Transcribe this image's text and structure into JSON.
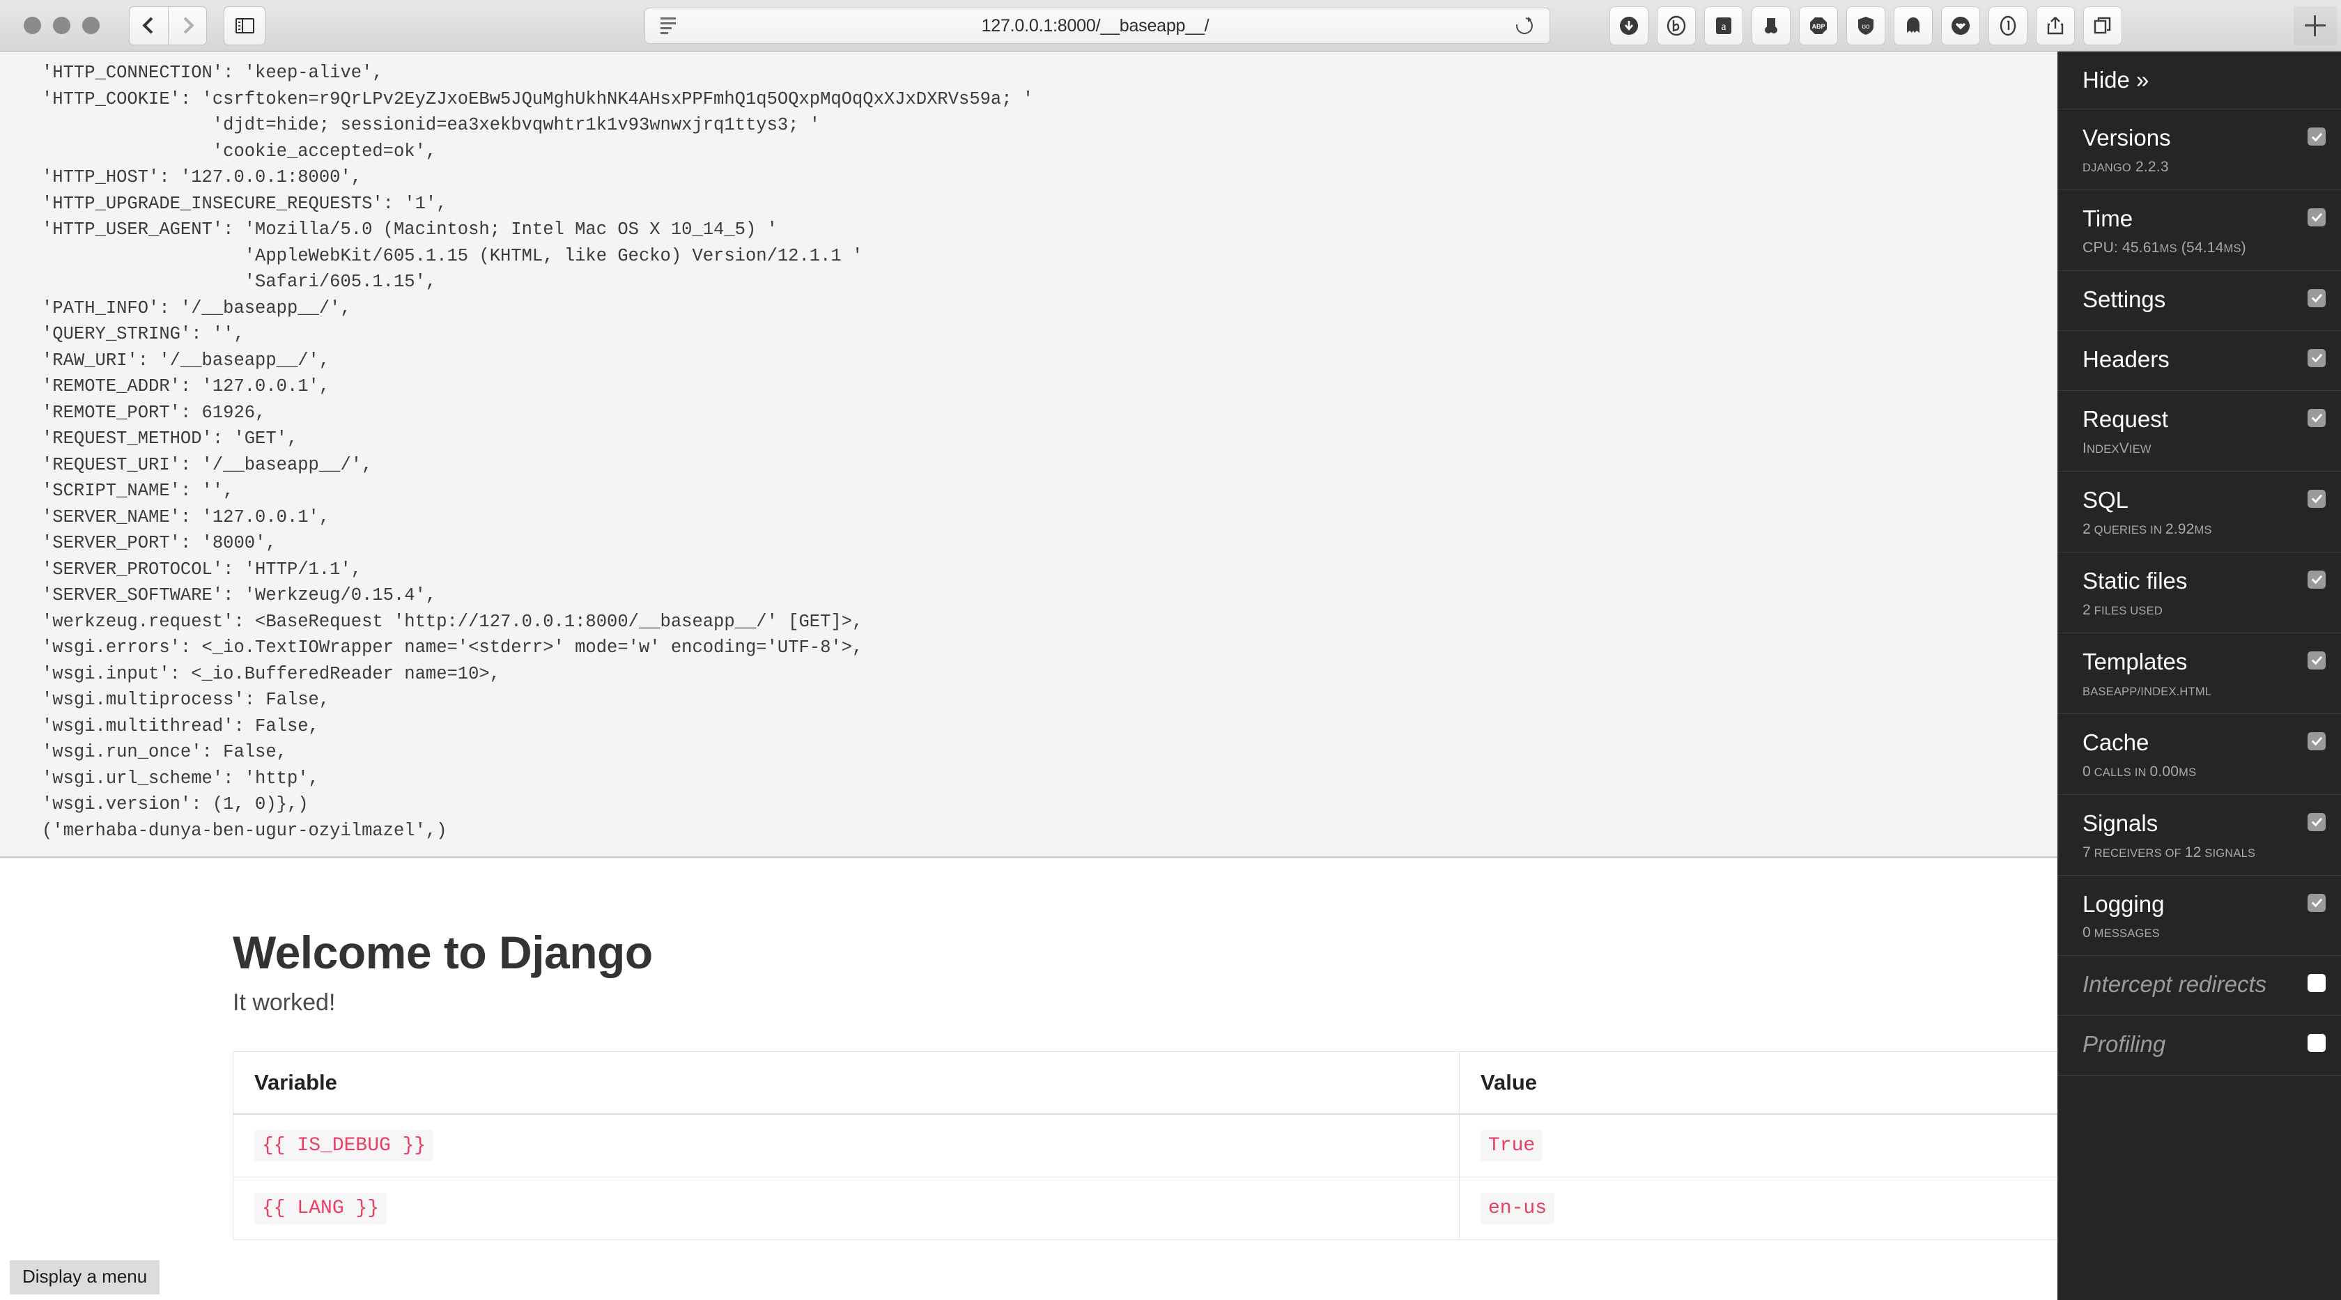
{
  "browser": {
    "window_controls": [
      "close",
      "minimize",
      "maximize"
    ],
    "back_label": "Back",
    "forward_label": "Forward",
    "sidebar_label": "Show sidebar",
    "reader_label": "Reader view",
    "url": "127.0.0.1:8000/__baseapp__/",
    "reload_label": "Reload",
    "new_tab_label": "New tab",
    "extensions": [
      "download-arrow-icon",
      "b-circle-icon",
      "amazon-icon",
      "nose-icon",
      "adblock-plus-icon",
      "ublock-origin-shield-icon",
      "ghostery-icon",
      "pocket-icon",
      "1password-icon",
      "share-icon",
      "tab-overview-icon"
    ]
  },
  "console": {
    "text": "'HTTP_CONNECTION': 'keep-alive',\n'HTTP_COOKIE': 'csrftoken=r9QrLPv2EyZJxoEBw5JQuMghUkhNK4AHsxPPFmhQ1q5OQxpMqOqQxXJxDXRVs59a; '\n                'djdt=hide; sessionid=ea3xekbvqwhtr1k1v93wnwxjrq1ttys3; '\n                'cookie_accepted=ok',\n'HTTP_HOST': '127.0.0.1:8000',\n'HTTP_UPGRADE_INSECURE_REQUESTS': '1',\n'HTTP_USER_AGENT': 'Mozilla/5.0 (Macintosh; Intel Mac OS X 10_14_5) '\n                   'AppleWebKit/605.1.15 (KHTML, like Gecko) Version/12.1.1 '\n                   'Safari/605.1.15',\n'PATH_INFO': '/__baseapp__/',\n'QUERY_STRING': '',\n'RAW_URI': '/__baseapp__/',\n'REMOTE_ADDR': '127.0.0.1',\n'REMOTE_PORT': 61926,\n'REQUEST_METHOD': 'GET',\n'REQUEST_URI': '/__baseapp__/',\n'SCRIPT_NAME': '',\n'SERVER_NAME': '127.0.0.1',\n'SERVER_PORT': '8000',\n'SERVER_PROTOCOL': 'HTTP/1.1',\n'SERVER_SOFTWARE': 'Werkzeug/0.15.4',\n'werkzeug.request': <BaseRequest 'http://127.0.0.1:8000/__baseapp__/' [GET]>,\n'wsgi.errors': <_io.TextIOWrapper name='<stderr>' mode='w' encoding='UTF-8'>,\n'wsgi.input': <_io.BufferedReader name=10>,\n'wsgi.multiprocess': False,\n'wsgi.multithread': False,\n'wsgi.run_once': False,\n'wsgi.url_scheme': 'http',\n'wsgi.version': (1, 0)},)\n('merhaba-dunya-ben-ugur-ozyilmazel',)"
  },
  "page": {
    "title": "Welcome to Django",
    "subtitle": "It worked!",
    "table": {
      "headers": [
        "Variable",
        "Value"
      ],
      "rows": [
        {
          "variable": "{{ IS_DEBUG }}",
          "value": "True"
        },
        {
          "variable": "{{ LANG }}",
          "value": "en-us"
        }
      ]
    }
  },
  "status_bar": {
    "text": "Display a menu"
  },
  "debug_toolbar": {
    "hide_label": "Hide »",
    "panels": [
      {
        "title": "Versions",
        "sub_parts": [
          {
            "t": "Django",
            "sc": true
          },
          {
            "t": " 2.2.3",
            "sc": false
          }
        ],
        "checked": true,
        "enabled": true
      },
      {
        "title": "Time",
        "sub_parts": [
          {
            "t": "CPU: 45.61",
            "sc": false
          },
          {
            "t": "ms",
            "sc": true
          },
          {
            "t": " (54.14",
            "sc": false
          },
          {
            "t": "ms",
            "sc": true
          },
          {
            "t": ")",
            "sc": false
          }
        ],
        "checked": true,
        "enabled": true
      },
      {
        "title": "Settings",
        "sub_parts": [],
        "checked": true,
        "enabled": true
      },
      {
        "title": "Headers",
        "sub_parts": [],
        "checked": true,
        "enabled": true
      },
      {
        "title": "Request",
        "sub_parts": [
          {
            "t": "I",
            "sc": false
          },
          {
            "t": "ndex",
            "sc": true
          },
          {
            "t": "V",
            "sc": false
          },
          {
            "t": "iew",
            "sc": true
          }
        ],
        "checked": true,
        "enabled": true
      },
      {
        "title": "SQL",
        "sub_parts": [
          {
            "t": "2",
            "sc": false
          },
          {
            "t": " queries in ",
            "sc": true
          },
          {
            "t": "2.92",
            "sc": false
          },
          {
            "t": "ms",
            "sc": true
          }
        ],
        "checked": true,
        "enabled": true
      },
      {
        "title": "Static files",
        "sub_parts": [
          {
            "t": "2",
            "sc": false
          },
          {
            "t": " files used",
            "sc": true
          }
        ],
        "checked": true,
        "enabled": true
      },
      {
        "title": "Templates",
        "sub_parts": [
          {
            "t": "baseapp/index.html",
            "sc": true
          }
        ],
        "checked": true,
        "enabled": true
      },
      {
        "title": "Cache",
        "sub_parts": [
          {
            "t": "0",
            "sc": false
          },
          {
            "t": " calls in ",
            "sc": true
          },
          {
            "t": "0.00",
            "sc": false
          },
          {
            "t": "ms",
            "sc": true
          }
        ],
        "checked": true,
        "enabled": true
      },
      {
        "title": "Signals",
        "sub_parts": [
          {
            "t": "7",
            "sc": false
          },
          {
            "t": " receivers of ",
            "sc": true
          },
          {
            "t": "12",
            "sc": false
          },
          {
            "t": " signals",
            "sc": true
          }
        ],
        "checked": true,
        "enabled": true
      },
      {
        "title": "Logging",
        "sub_parts": [
          {
            "t": "0",
            "sc": false
          },
          {
            "t": " messages",
            "sc": true
          }
        ],
        "checked": true,
        "enabled": true
      },
      {
        "title": "Intercept redirects",
        "sub_parts": [],
        "checked": false,
        "enabled": false
      },
      {
        "title": "Profiling",
        "sub_parts": [],
        "checked": false,
        "enabled": false
      }
    ]
  },
  "colors": {
    "toolbar_bg": "#252525",
    "console_bg": "#f4f4f4",
    "code_accent": "#e83e63",
    "chrome_bg": "#d6d6d6"
  }
}
